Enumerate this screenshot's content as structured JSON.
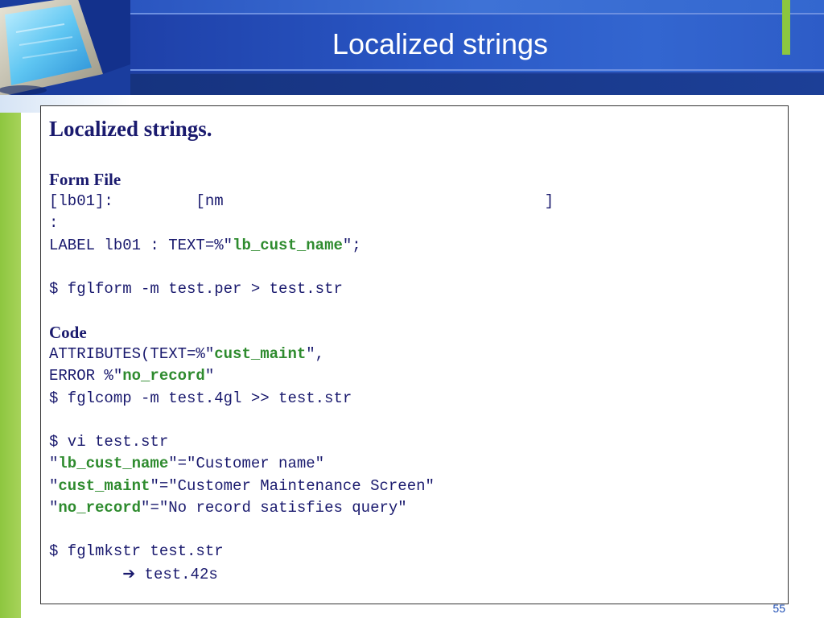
{
  "slide": {
    "title": "Localized strings",
    "heading": "Localized strings.",
    "slide_number": "55"
  },
  "form_section": {
    "heading": "Form File",
    "line1": "[lb01]:         [nm                                   ]",
    "line2": ":",
    "line3_prefix": "LABEL lb01 : TEXT=%\"",
    "line3_key": "lb_cust_name",
    "line3_suffix": "\";",
    "command": "$ fglform -m test.per > test.str"
  },
  "code_section": {
    "heading": "Code",
    "attr_prefix": "ATTRIBUTES(TEXT=%\"",
    "attr_key": "cust_maint",
    "attr_suffix": "\",",
    "error_prefix": "ERROR %\"",
    "error_key": "no_record",
    "error_suffix": "\"",
    "command": "$ fglcomp -m test.4gl >> test.str"
  },
  "str_section": {
    "command": "$ vi test.str",
    "entries": [
      {
        "key": "lb_cust_name",
        "value": "=\"Customer name\""
      },
      {
        "key": "cust_maint",
        "value": "=\"Customer Maintenance Screen\""
      },
      {
        "key": "no_record",
        "value": "=\"No record satisfies query\""
      }
    ]
  },
  "mkstr_section": {
    "command": "$ fglmkstr test.str",
    "arrow_icon": "right-arrow-icon",
    "output": "test.42s"
  },
  "colors": {
    "header_blue": "#1f3f9c",
    "accent_green": "#8cc63f",
    "text_navy": "#1a1a6e",
    "key_green": "#2e8b2e"
  }
}
